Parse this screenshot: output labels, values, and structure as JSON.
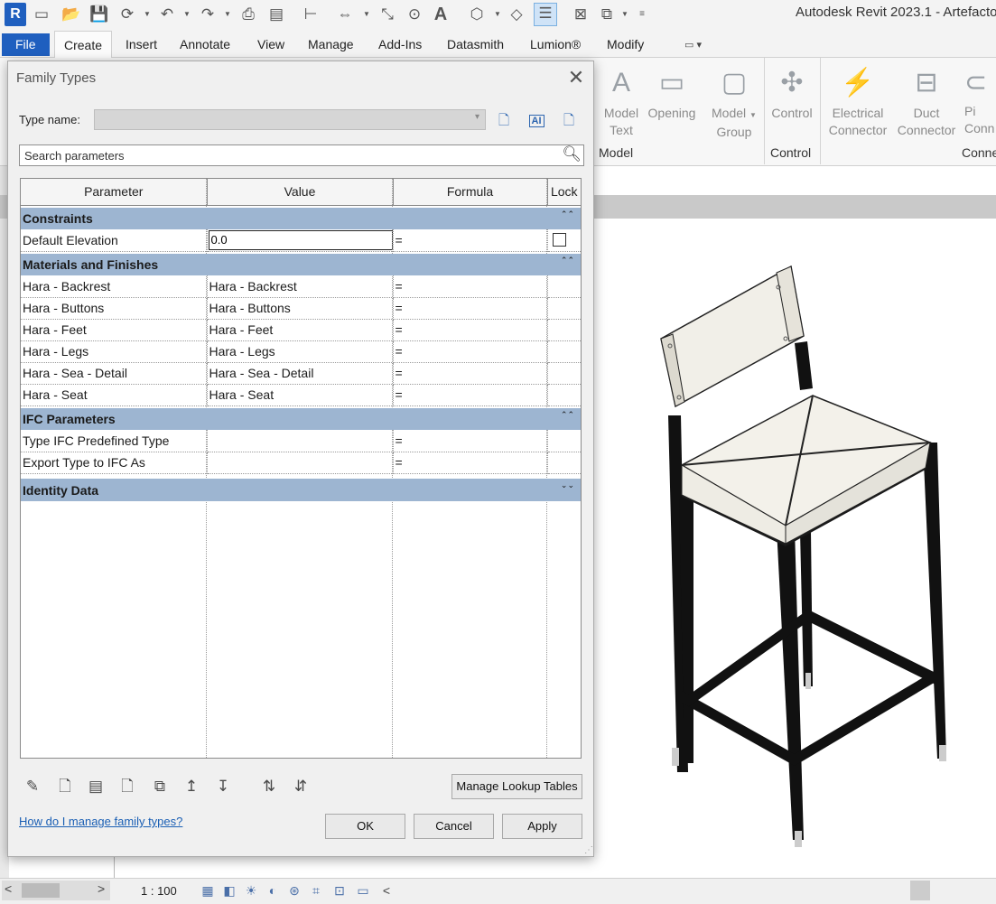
{
  "app": {
    "title": "Autodesk Revit 2023.1 - Artefacto",
    "logo": "R"
  },
  "qat_icons": [
    "open-icon",
    "save-icon",
    "sync-icon",
    "undo-icon",
    "redo-icon",
    "print-icon",
    "measure-icon",
    "align-icon",
    "dimension-icon",
    "text-icon",
    "3d-view-icon",
    "thin-lines-icon",
    "close-windows-icon",
    "switch-windows-icon"
  ],
  "ribbon": {
    "tabs": [
      "File",
      "Create",
      "Insert",
      "Annotate",
      "View",
      "Manage",
      "Add-Ins",
      "Datasmith",
      "Lumion®",
      "Modify"
    ],
    "active_tab": "Create",
    "buttons": [
      {
        "label1": "Model",
        "label2": "Text"
      },
      {
        "label1": "Opening",
        "label2": ""
      },
      {
        "label1": "Model",
        "label2": "Group"
      },
      {
        "label1": "Control",
        "label2": ""
      },
      {
        "label1": "Electrical",
        "label2": "Connector"
      },
      {
        "label1": "Duct",
        "label2": "Connector"
      },
      {
        "label1": "Pi",
        "label2": "Conn"
      }
    ],
    "panels": [
      "Model",
      "Control",
      "Conne"
    ]
  },
  "dialog": {
    "title": "Family Types",
    "type_name_label": "Type name:",
    "type_name_value": "",
    "search_placeholder": "Search parameters",
    "columns": [
      "Parameter",
      "Value",
      "Formula",
      "Lock"
    ],
    "groups": {
      "constraints": {
        "name": "Constraints",
        "rows": [
          {
            "param": "Default Elevation",
            "value": "0.0",
            "formula": "="
          }
        ]
      },
      "materials": {
        "name": "Materials and Finishes",
        "rows": [
          {
            "param": "Hara - Backrest",
            "value": "Hara - Backrest",
            "formula": "="
          },
          {
            "param": "Hara - Buttons",
            "value": "Hara - Buttons",
            "formula": "="
          },
          {
            "param": "Hara - Feet",
            "value": "Hara - Feet",
            "formula": "="
          },
          {
            "param": "Hara - Legs",
            "value": "Hara - Legs",
            "formula": "="
          },
          {
            "param": "Hara - Sea - Detail",
            "value": "Hara - Sea - Detail",
            "formula": "="
          },
          {
            "param": "Hara - Seat",
            "value": "Hara - Seat",
            "formula": "="
          }
        ]
      },
      "ifc": {
        "name": "IFC Parameters",
        "rows": [
          {
            "param": "Type IFC Predefined Type",
            "value": "",
            "formula": "="
          },
          {
            "param": "Export Type to IFC As",
            "value": "",
            "formula": "="
          }
        ]
      },
      "identity": {
        "name": "Identity Data",
        "rows": []
      }
    },
    "manage_lookup_label": "Manage Lookup Tables",
    "help_link": "How do I manage family types?",
    "ok_label": "OK",
    "cancel_label": "Cancel",
    "apply_label": "Apply"
  },
  "status": {
    "scale": "1 : 100"
  }
}
